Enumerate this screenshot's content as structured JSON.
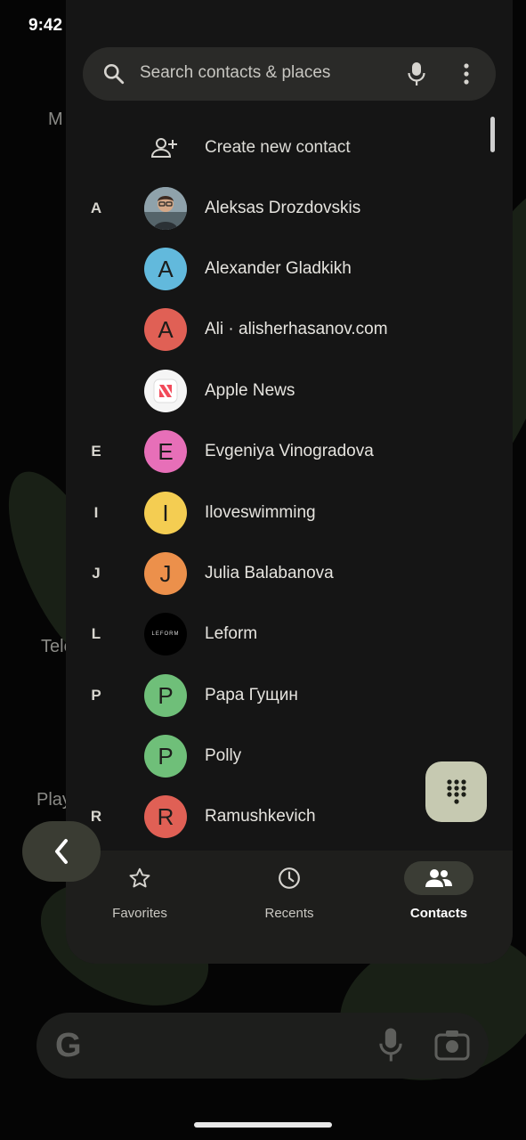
{
  "status_bar": {
    "time": "9:42"
  },
  "background": {
    "partial_texts": [
      "M",
      "Tele",
      "Play"
    ]
  },
  "search": {
    "placeholder": "Search contacts & places"
  },
  "create_contact": {
    "label": "Create new contact"
  },
  "contacts": [
    {
      "letter": "A",
      "initial": "",
      "name": "Aleksas Drozdovskis",
      "avatar_color": "#6b7d86",
      "avatar_kind": "photo"
    },
    {
      "letter": "",
      "initial": "A",
      "name": "Alexander Gladkikh",
      "avatar_color": "#62b9dc",
      "avatar_kind": "initial"
    },
    {
      "letter": "",
      "initial": "A",
      "name": "Ali · alisherhasanov.com",
      "avatar_color": "#e06055",
      "avatar_kind": "initial"
    },
    {
      "letter": "",
      "initial": "",
      "name": "Apple News",
      "avatar_color": "#f5f5f5",
      "avatar_kind": "news-logo"
    },
    {
      "letter": "E",
      "initial": "E",
      "name": "Evgeniya Vinogradova",
      "avatar_color": "#e76fb8",
      "avatar_kind": "initial"
    },
    {
      "letter": "I",
      "initial": "I",
      "name": "Iloveswimming",
      "avatar_color": "#f4cd52",
      "avatar_kind": "initial"
    },
    {
      "letter": "J",
      "initial": "J",
      "name": "Julia Balabanova",
      "avatar_color": "#ec904b",
      "avatar_kind": "initial"
    },
    {
      "letter": "L",
      "initial": "LEFORM",
      "name": "Leform",
      "avatar_color": "#000000",
      "avatar_kind": "text-logo"
    },
    {
      "letter": "P",
      "initial": "P",
      "name": "Papa Гущин",
      "avatar_color": "#6fbf79",
      "avatar_kind": "initial"
    },
    {
      "letter": "",
      "initial": "P",
      "name": "Polly",
      "avatar_color": "#6fbf79",
      "avatar_kind": "initial"
    },
    {
      "letter": "R",
      "initial": "R",
      "name": "Ramushkevich",
      "avatar_color": "#e06055",
      "avatar_kind": "initial"
    }
  ],
  "bottom_nav": {
    "favorites": "Favorites",
    "recents": "Recents",
    "contacts": "Contacts",
    "active": "contacts"
  },
  "icons": {
    "search": "search-icon",
    "mic": "mic-icon",
    "more": "more-vert-icon",
    "add_person": "person-add-icon",
    "dialpad": "dialpad-icon",
    "back": "chevron-left-icon"
  },
  "colors": {
    "panel_bg": "#151515",
    "search_bg": "#2a2a28",
    "fab_bg": "#c6c9b1",
    "nav_active_bg": "#3b3d35"
  }
}
